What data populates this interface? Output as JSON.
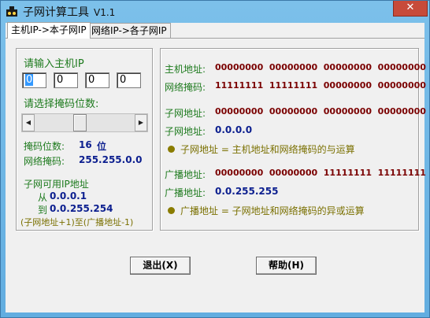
{
  "window": {
    "title": "子网计算工具",
    "version": "V1.1",
    "close_glyph": "✕"
  },
  "tabs": [
    {
      "label": "主机IP->本子网IP",
      "active": true
    },
    {
      "label": "网络IP->各子网IP",
      "active": false
    }
  ],
  "left_panel": {
    "host_ip_label": "请输入主机IP",
    "ip_octets": [
      "0",
      "0",
      "0",
      "0"
    ],
    "mask_select_label": "请选择掩码位数:",
    "mask_bits_label": "掩码位数:",
    "mask_bits_value": "16",
    "mask_bits_unit": "位",
    "netmask_label": "网络掩码:",
    "netmask_value": "255.255.0.0",
    "usable_title": "子网可用IP地址",
    "from_label": "从",
    "from_value": "0.0.0.1",
    "to_label": "到",
    "to_value": "0.0.255.254",
    "range_note": "(子网地址+1)至(广播地址-1)",
    "scroll_left_glyph": "◀",
    "scroll_right_glyph": "▶"
  },
  "right_panel": {
    "host_addr_label": "主机地址:",
    "host_addr_bits": "00000000  00000000  00000000  00000000",
    "netmask_label": "网络掩码:",
    "netmask_bits": "11111111  11111111  00000000  00000000",
    "subnet_addr_label": "子网地址:",
    "subnet_addr_bits": "00000000  00000000  00000000  00000000",
    "subnet_label": "子网地址:",
    "subnet_value": "0.0.0.0",
    "subnet_formula": "子网地址 = 主机地址和网络掩码的与运算",
    "broadcast_addr_label": "广播地址:",
    "broadcast_addr_bits": "00000000  00000000  11111111  11111111",
    "broadcast_label": "广播地址:",
    "broadcast_value": "0.0.255.255",
    "broadcast_formula": "广播地址 = 子网地址和网络掩码的异或运算"
  },
  "buttons": {
    "exit_label": "退出(X)",
    "help_label": "帮助(H)"
  },
  "colors": {
    "label_green": "#1d7a1d",
    "value_navy": "#0c1f8f",
    "bits_maroon": "#7a0000",
    "formula_olive": "#7a7000",
    "title_bar": "#62ade0"
  }
}
